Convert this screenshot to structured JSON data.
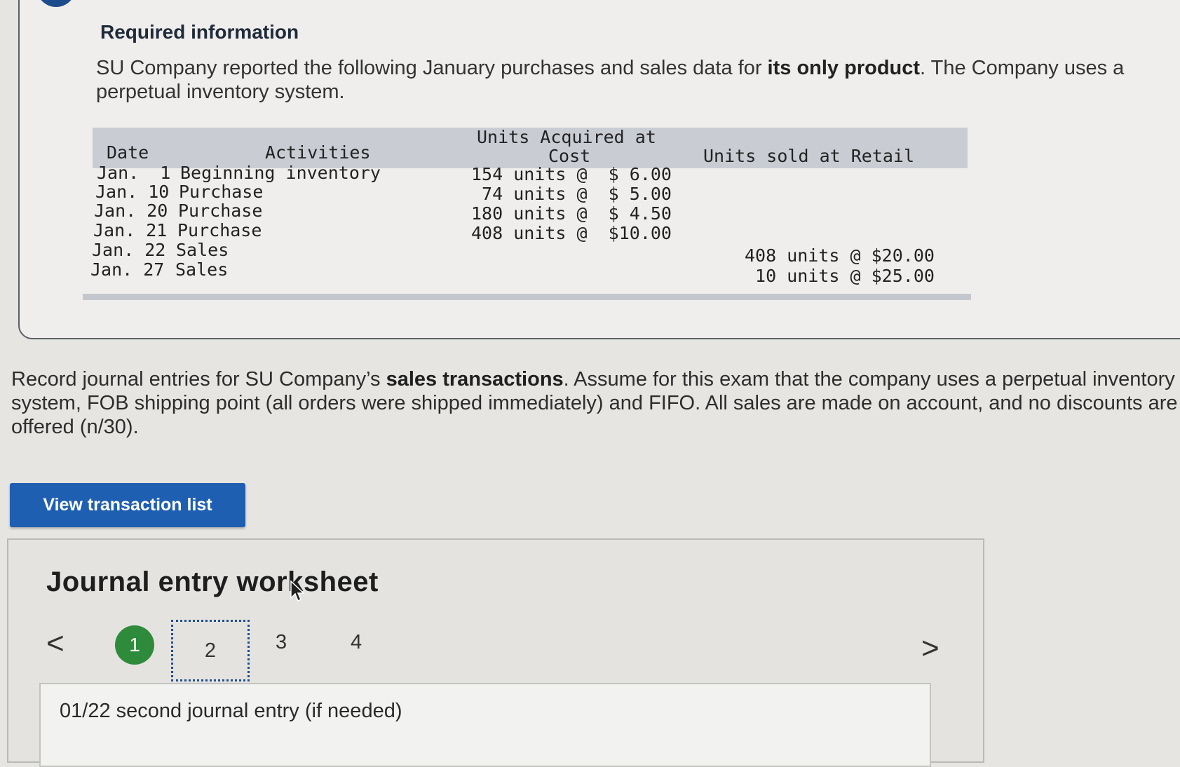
{
  "info": {
    "title": "Required information",
    "intro_before": "SU Company reported the following January purchases and sales data for ",
    "intro_bold": "its only product",
    "intro_after": ". The Company uses a perpetual inventory system."
  },
  "table": {
    "headers": {
      "date": "Date",
      "activities": "Activities",
      "acquired_line1": "Units Acquired at",
      "acquired_line2": "Cost",
      "sold": "Units sold at Retail"
    },
    "rows": [
      {
        "date": "Jan.  1",
        "activity": "Beginning inventory",
        "acquired": "154 units @  $ 6.00",
        "sold": ""
      },
      {
        "date": "Jan. 10",
        "activity": "Purchase",
        "acquired": " 74 units @  $ 5.00",
        "sold": ""
      },
      {
        "date": "Jan. 20",
        "activity": "Purchase",
        "acquired": "180 units @  $ 4.50",
        "sold": ""
      },
      {
        "date": "Jan. 21",
        "activity": "Purchase",
        "acquired": "408 units @  $10.00",
        "sold": ""
      },
      {
        "date": "Jan. 22",
        "activity": "Sales",
        "acquired": "",
        "sold": "408 units @ $20.00"
      },
      {
        "date": "Jan. 27",
        "activity": "Sales",
        "acquired": "",
        "sold": " 10 units @ $25.00"
      }
    ]
  },
  "task": {
    "before": "Record journal entries for SU Company’s ",
    "bold": "sales transactions",
    "after": ". Assume for this exam that the company uses a perpetual inventory system, FOB shipping point (all orders were shipped immediately) and FIFO. All sales are made on account, and no discounts are offered (n/30)."
  },
  "buttons": {
    "view_transactions": "View transaction list"
  },
  "worksheet": {
    "title": "Journal entry worksheet",
    "prev": "<",
    "next": ">",
    "steps": [
      "1",
      "2",
      "3",
      "4"
    ],
    "entry_label": "01/22 second journal entry (if needed)"
  },
  "colors": {
    "primary_button": "#1f5fb2",
    "step_complete": "#2e8b3b",
    "table_header": "#c9cdd3"
  }
}
